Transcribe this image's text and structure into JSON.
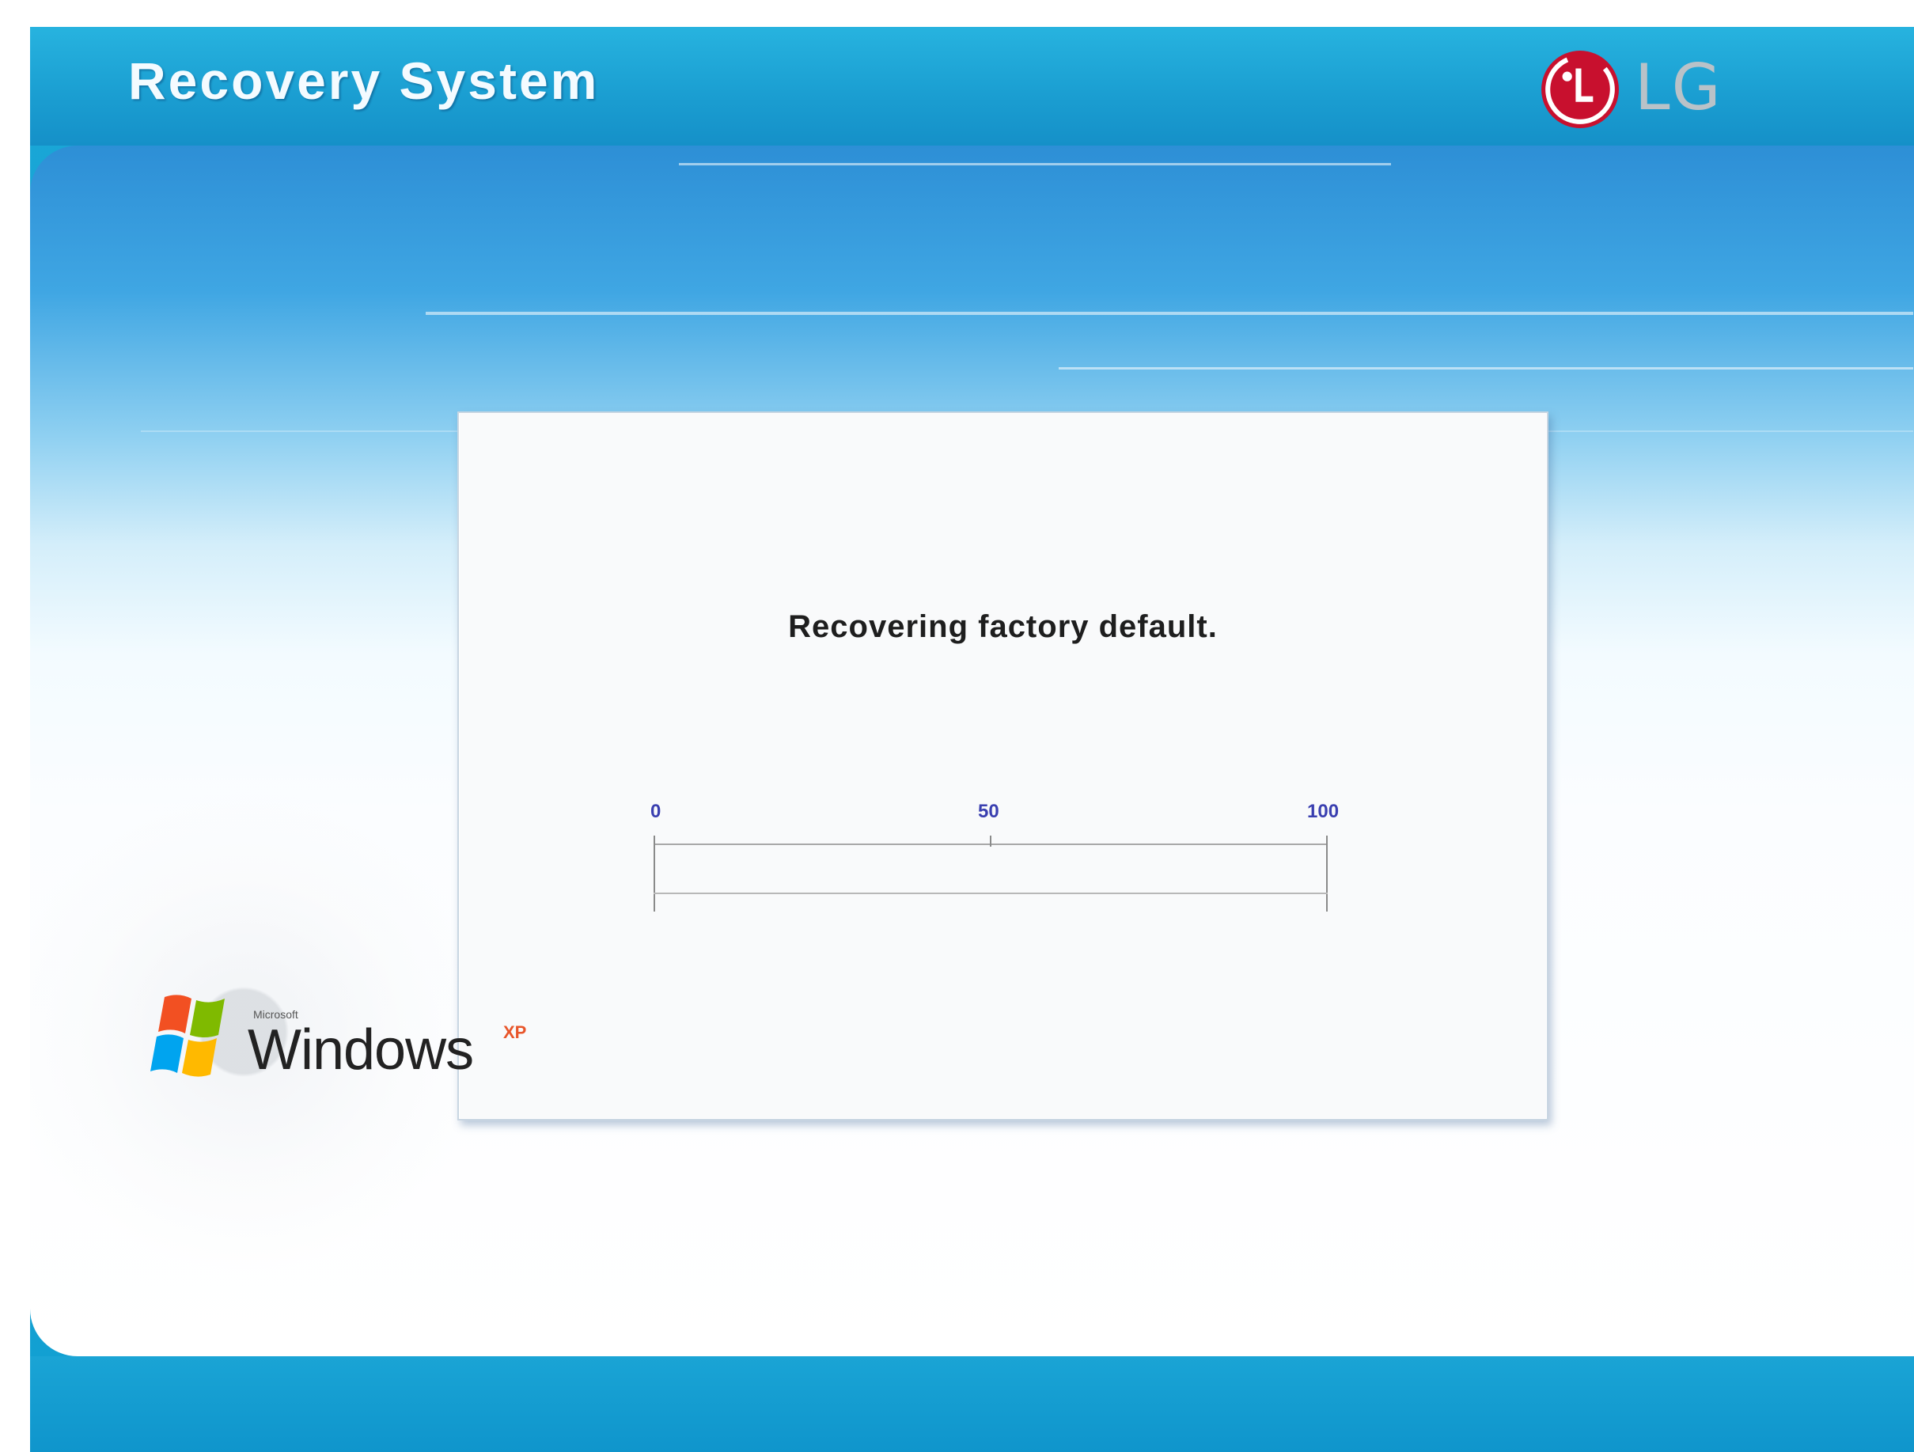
{
  "header": {
    "title": "Recovery System",
    "brand": "LG",
    "brand_color": "#c8102e"
  },
  "dialog": {
    "status_text": "Recovering factory default.",
    "progress": {
      "value_percent": 0,
      "scale_labels": [
        "0",
        "50",
        "100"
      ]
    }
  },
  "footer": {
    "os_logo_name": "windows-xp-logo",
    "os_brand_small": "Microsoft",
    "os_brand": "Windows",
    "os_edition": "XP"
  },
  "colors": {
    "accent_blue": "#1aa6d6",
    "panel_bg": "#f9fafb",
    "scale_label_color": "#3a3fb0"
  }
}
